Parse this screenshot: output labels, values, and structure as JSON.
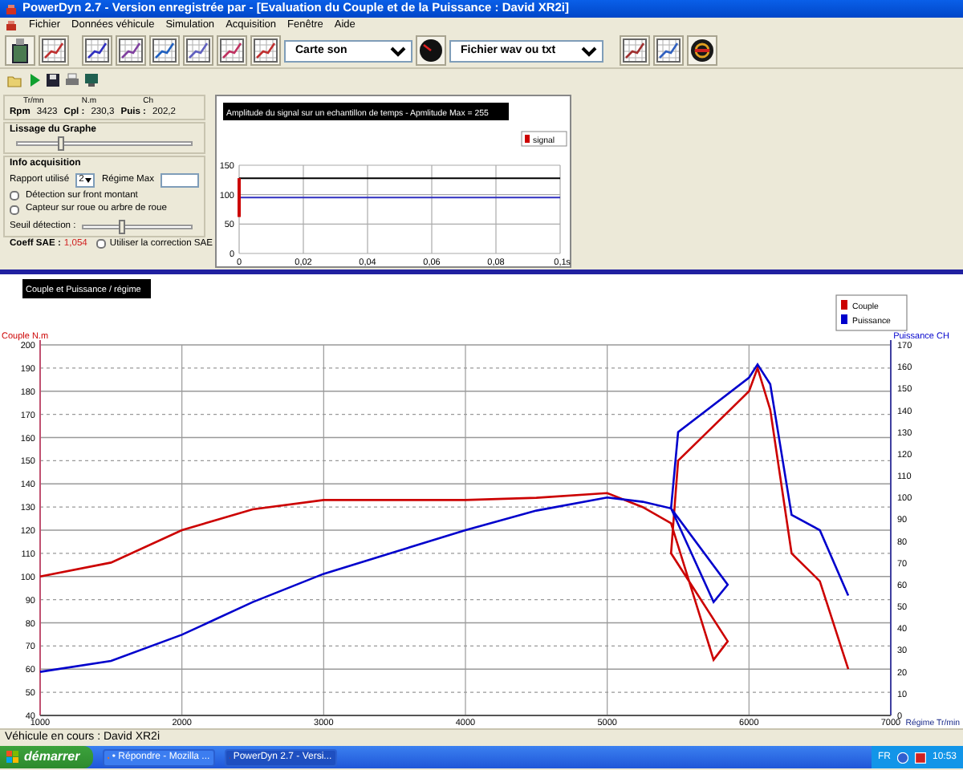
{
  "window": {
    "title": "PowerDyn 2.7 - Version enregistrée par  -  [Evaluation du Couple et de la Puissance : David XR2i]"
  },
  "menu": [
    "Fichier",
    "Données véhicule",
    "Simulation",
    "Acquisition",
    "Fenêtre",
    "Aide"
  ],
  "toolbar": {
    "source_select": "Carte son",
    "file_select": "Fichier wav ou txt"
  },
  "readings": [
    {
      "unit": "Tr/mn",
      "label": "Rpm",
      "value": "3423"
    },
    {
      "unit": "N.m",
      "label": "Cpl :",
      "value": "230,3"
    },
    {
      "unit": "Ch",
      "label": "Puis :",
      "value": "202,2"
    }
  ],
  "smoothing": {
    "title": "Lissage du Graphe",
    "level": 0.25
  },
  "acquisition": {
    "title": "Info acquisition",
    "ratio_label": "Rapport utilisé",
    "ratio_value": "2",
    "max_rpm_label": "Régime Max",
    "options": [
      {
        "label": "Détection sur front montant",
        "checked": false
      },
      {
        "label": "Capteur sur roue ou arbre de roue",
        "checked": false
      }
    ],
    "threshold": {
      "label": "Seuil détection :",
      "level": 0.35
    }
  },
  "sae": {
    "label": "Coeff SAE :",
    "value": "1,054",
    "checkbox": {
      "label": "Utiliser la correction SAE",
      "checked": false
    }
  },
  "signal_chart": {
    "chart_data": {
      "type": "line",
      "title": "Amplitude du signal sur un echantillon de temps - Apmlitude Max = 255",
      "xlabel": "s",
      "x": [
        0,
        0
      ],
      "series": [
        {
          "name": "signal",
          "color": "#cc0000",
          "values": [
            62,
            128
          ]
        }
      ],
      "xlim": [
        0,
        0.1
      ],
      "ylim": [
        0,
        150
      ],
      "xticks": [
        0,
        {
          "value": 0.02,
          "label": "0,02"
        },
        {
          "value": 0.04,
          "label": "0,04"
        },
        {
          "value": 0.06,
          "label": "0,06"
        },
        {
          "value": 0.08,
          "label": "0,08"
        },
        {
          "value": 0.1,
          "label": "0,1"
        }
      ],
      "yticks": [
        0,
        50,
        100,
        150
      ],
      "grid": true,
      "ref_lines": [
        {
          "axis": "y",
          "value": 128,
          "color": "#000000"
        },
        {
          "axis": "y",
          "value": 95,
          "color": "#3030c0"
        }
      ]
    }
  },
  "main_chart": {
    "chart_data": {
      "type": "line",
      "title": "Couple et Puissance / régime",
      "xlabel": "Régime Tr/min",
      "ylabel": "Couple N.m",
      "y2label": "Puissance CH",
      "grid": true,
      "legend": "upper right",
      "x": [
        1000,
        1500,
        2000,
        2500,
        3000,
        3500,
        4000,
        4500,
        5000,
        5250,
        5450,
        5750,
        5850,
        5450,
        5500,
        6000,
        6060,
        6150,
        6300,
        6500,
        6700
      ],
      "series": [
        {
          "name": "Couple",
          "color": "#cc0000",
          "values": [
            100,
            106,
            120,
            129,
            133,
            133,
            133,
            134,
            136,
            130,
            123,
            64,
            72,
            110,
            150,
            180,
            190,
            172,
            110,
            98,
            60
          ]
        },
        {
          "name": "Puissance",
          "color": "#0000cc",
          "axis": "y2",
          "values": [
            20,
            25,
            37,
            52,
            65,
            75,
            85,
            94,
            100,
            98,
            95,
            52,
            60,
            95,
            130,
            155,
            161,
            152,
            92,
            85,
            55
          ]
        }
      ],
      "xlim": [
        1000,
        7000
      ],
      "ylim": [
        40,
        200
      ],
      "y2lim": [
        0,
        170
      ],
      "xticks": [
        1000,
        2000,
        3000,
        4000,
        5000,
        6000,
        7000
      ],
      "yticks": [
        40,
        50,
        60,
        70,
        80,
        90,
        100,
        110,
        120,
        130,
        140,
        150,
        160,
        170,
        180,
        190,
        200
      ],
      "y2ticks": [
        0,
        10,
        20,
        30,
        40,
        50,
        60,
        70,
        80,
        90,
        100,
        110,
        120,
        130,
        140,
        150,
        160,
        170
      ]
    }
  },
  "status_bar": "Véhicule en cours : David XR2i",
  "taskbar": {
    "start": "démarrer",
    "tasks": [
      {
        "label": "• Répondre - Mozilla ...",
        "selected": false
      },
      {
        "label": "PowerDyn 2.7 - Versi...",
        "selected": true
      }
    ],
    "language": "FR",
    "clock": "10:53"
  }
}
